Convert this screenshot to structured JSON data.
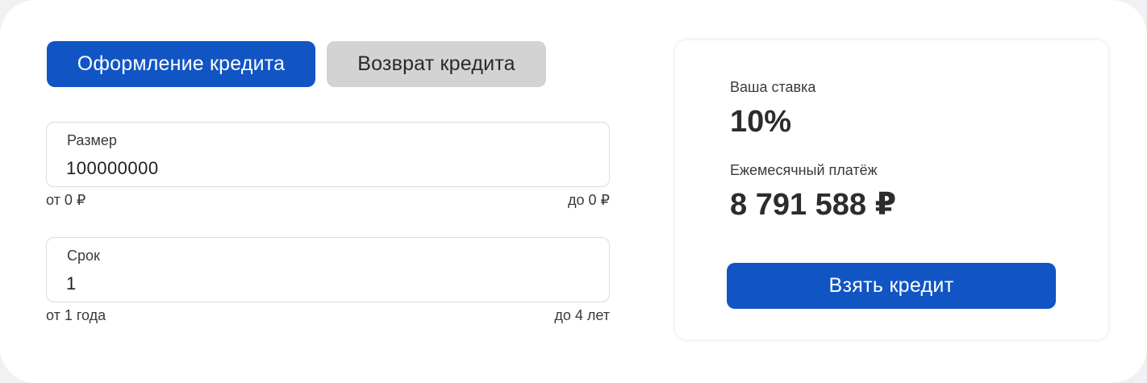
{
  "tabs": {
    "apply_label": "Оформление кредита",
    "repay_label": "Возврат кредита"
  },
  "amount": {
    "label": "Размер",
    "value": "100000000",
    "min_hint": "от 0 ₽",
    "max_hint": "до 0 ₽"
  },
  "term": {
    "label": "Срок",
    "value": "1",
    "min_hint": "от 1 года",
    "max_hint": "до 4 лет"
  },
  "summary": {
    "rate_label": "Ваша ставка",
    "rate_value": "10%",
    "payment_label": "Ежемесячный платёж",
    "payment_value": "8 791 588 ₽",
    "cta_label": "Взять кредит"
  },
  "colors": {
    "accent": "#1155c4",
    "inactive_tab": "#d3d3d3",
    "page_background": "#f1f1f3"
  }
}
